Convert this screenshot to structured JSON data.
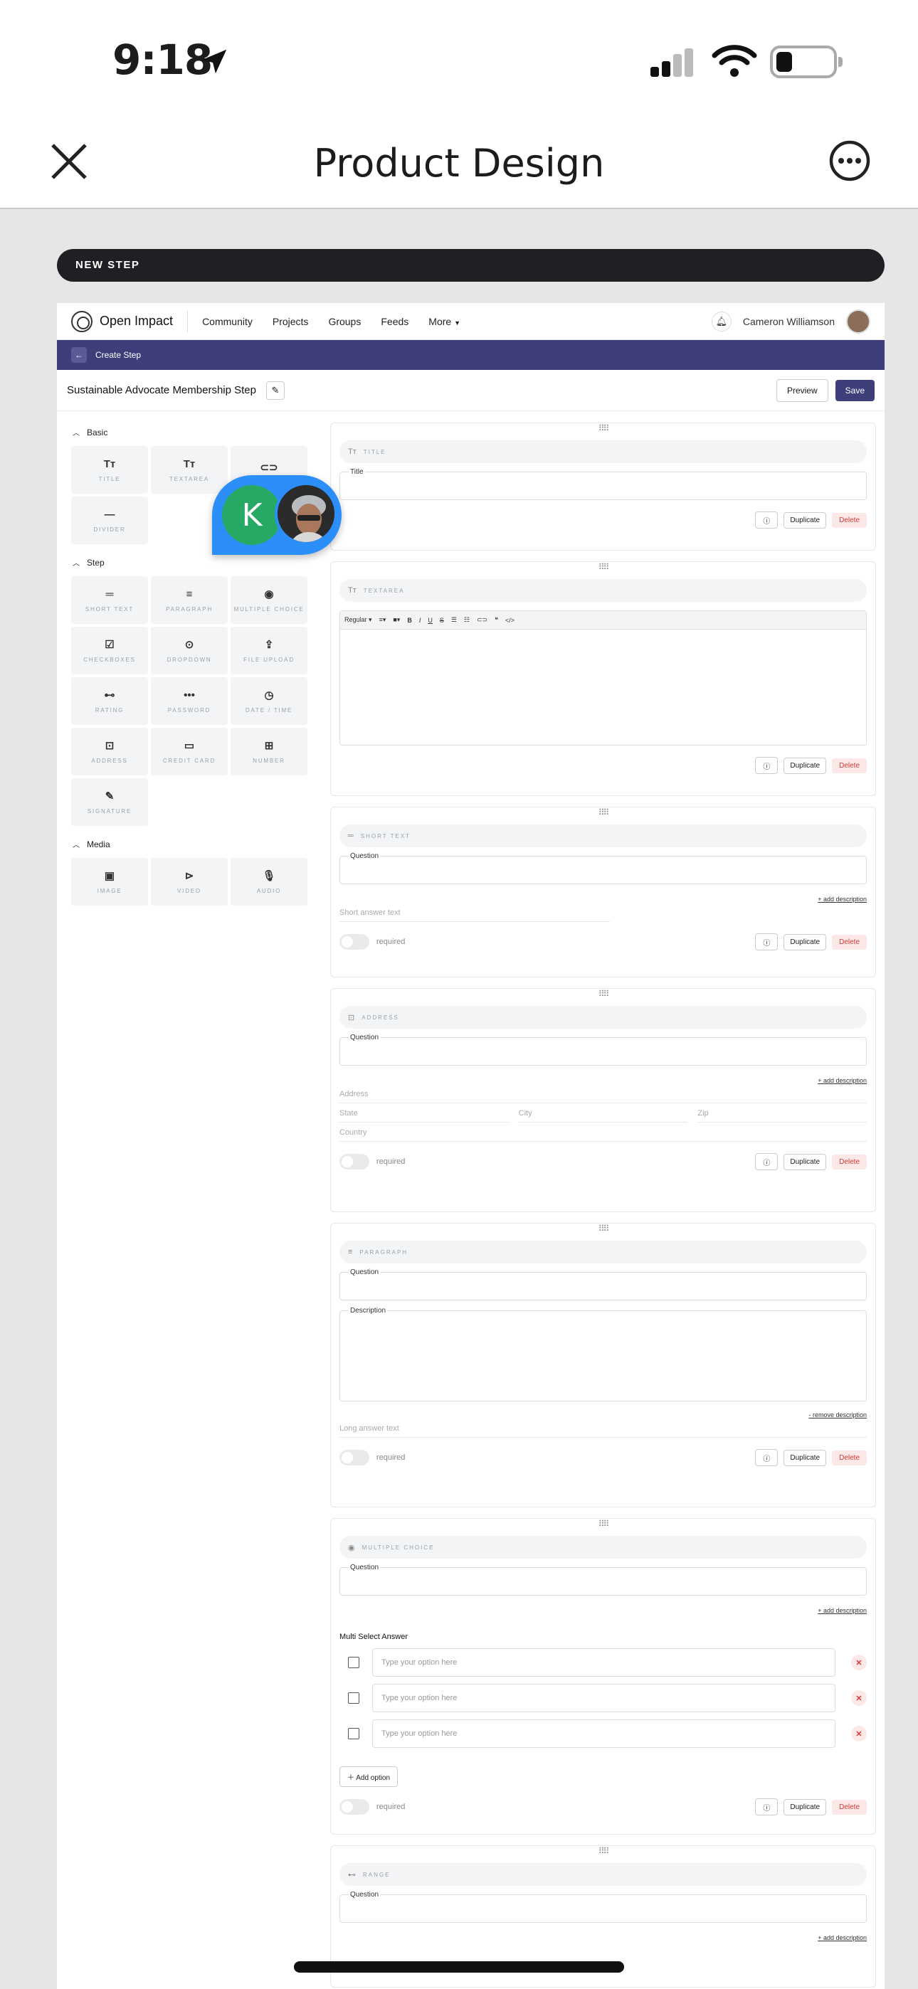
{
  "status_bar": {
    "time": "9:18"
  },
  "nav": {
    "title": "Product Design"
  },
  "banner": {
    "label": "NEW STEP"
  },
  "app": {
    "brand": "Open Impact",
    "menu": [
      "Community",
      "Projects",
      "Groups",
      "Feeds",
      "More"
    ],
    "user_name": "Cameron Williamson",
    "header_label": "Create Step",
    "step_title": "Sustainable Advocate Membership Step",
    "preview_label": "Preview",
    "save_label": "Save"
  },
  "sidebar": {
    "basic": {
      "label": "Basic",
      "items": [
        "TITLE",
        "TEXTAREA",
        "",
        "DIVIDER"
      ]
    },
    "step": {
      "label": "Step",
      "items": [
        "SHORT TEXT",
        "PARAGRAPH",
        "MULTIPLE CHOICE",
        "CHECKBOXES",
        "DROPDOWN",
        "FILE UPLOAD",
        "RATING",
        "PASSWORD",
        "DATE / TIME",
        "ADDRESS",
        "CREDIT CARD",
        "NUMBER",
        "SIGNATURE"
      ]
    },
    "media": {
      "label": "Media",
      "items": [
        "IMAGE",
        "VIDEO",
        "AUDIO"
      ]
    }
  },
  "floating": {
    "initial": "K"
  },
  "common": {
    "duplicate": "Duplicate",
    "delete": "Delete",
    "required": "required",
    "add_description": "+ add description",
    "remove_description": "- remove description",
    "question": "Question"
  },
  "cards": {
    "title": {
      "chip": "TITLE",
      "field": "Title"
    },
    "textarea": {
      "chip": "TEXTAREA",
      "style": "Regular"
    },
    "short_text": {
      "chip": "SHORT TEXT",
      "placeholder": "Short answer text"
    },
    "address": {
      "chip": "ADDRESS",
      "address": "Address",
      "state": "State",
      "city": "City",
      "zip": "Zip",
      "country": "Country"
    },
    "paragraph": {
      "chip": "PARAGRAPH",
      "description": "Description",
      "placeholder": "Long answer text"
    },
    "multiple_choice": {
      "chip": "MULTIPLE CHOICE",
      "subtitle": "Multi Select Answer",
      "options": [
        "Type your option here",
        "Type your option here",
        "Type your option here"
      ],
      "add_option": "Add option"
    },
    "range": {
      "chip": "RANGE"
    }
  }
}
